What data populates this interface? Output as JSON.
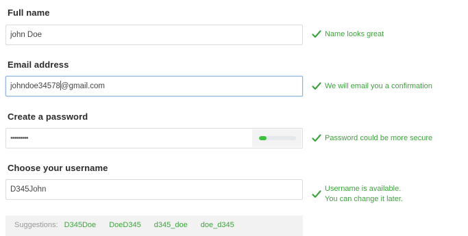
{
  "form": {
    "full_name": {
      "label": "Full name",
      "value": "john Doe",
      "hint": "Name looks great"
    },
    "email": {
      "label": "Email address",
      "value_before_caret": "johndoe34578",
      "value_after_caret": "@gmail.com",
      "hint": "We will email you a confirmation"
    },
    "password": {
      "label": "Create a password",
      "masked_value": "•••••••••",
      "strength_fraction": 0.2,
      "hint": "Password could be more secure"
    },
    "username": {
      "label": "Choose your username",
      "value": "D345John",
      "hint_line1": "Username is available.",
      "hint_line2": "You can change it later."
    },
    "suggestions": {
      "label": "Suggestions:",
      "items": [
        "D345Doe",
        "DoeD345",
        "d345_doe",
        "doe_d345"
      ]
    }
  },
  "colors": {
    "success_green": "#3ea33e",
    "strength_fill": "#3ec23e",
    "focus_border": "#8fb2dc"
  },
  "icons": {
    "hint_icon": "checkmark-icon"
  }
}
